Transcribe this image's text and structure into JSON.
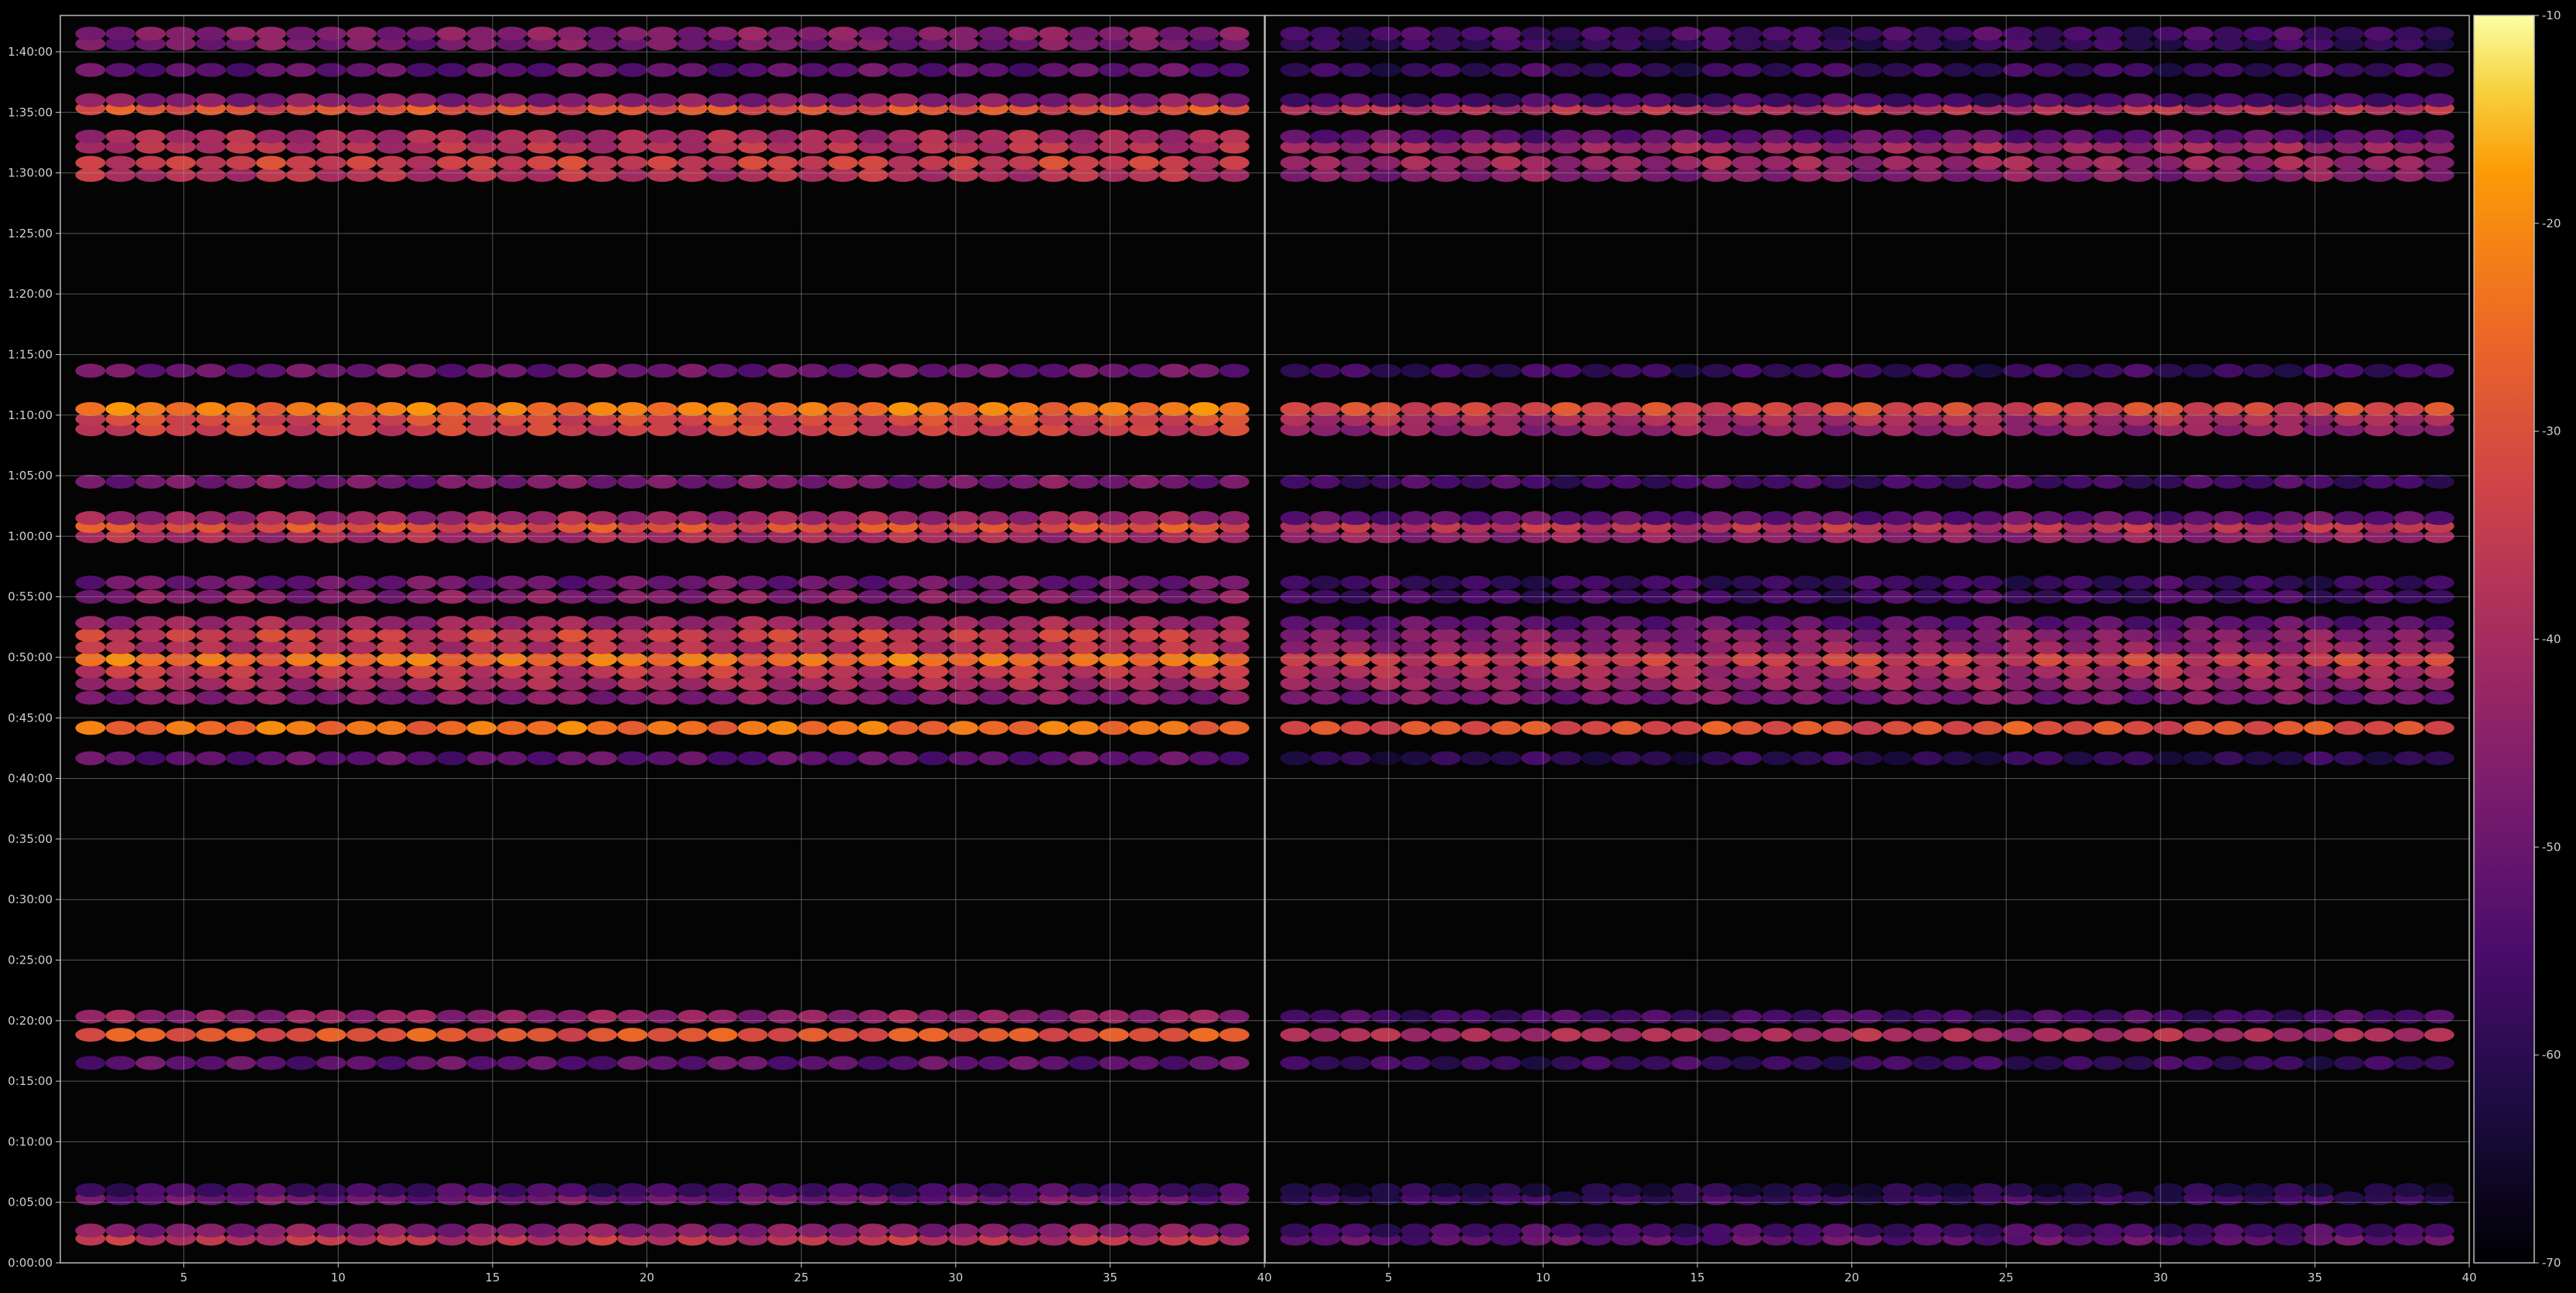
{
  "chart_data": {
    "type": "heatmap",
    "title": "",
    "xlabel": "",
    "ylabel": "",
    "panels": [
      {
        "name": "",
        "xlim": [
          1,
          40
        ],
        "x_ticks": [
          5,
          10,
          15,
          20,
          25,
          30,
          35,
          40
        ]
      },
      {
        "name": "",
        "xlim": [
          1,
          40
        ],
        "x_ticks": [
          5,
          10,
          15,
          20,
          25,
          30,
          35,
          40
        ]
      }
    ],
    "y_range_seconds": [
      0,
      6180
    ],
    "y_ticks": [
      "0:00:00",
      "0:05:00",
      "0:10:00",
      "0:15:00",
      "0:20:00",
      "0:25:00",
      "0:30:00",
      "0:35:00",
      "0:40:00",
      "0:45:00",
      "0:50:00",
      "0:55:00",
      "1:00:00",
      "1:05:00",
      "1:10:00",
      "1:15:00",
      "1:20:00",
      "1:25:00",
      "1:30:00",
      "1:35:00",
      "1:40:00"
    ],
    "grid": true,
    "colormap": "inferno",
    "colorbar": {
      "range": [
        -70,
        -10
      ],
      "ticks": [
        "-10",
        "-20",
        "-30",
        "-40",
        "-50",
        "-60",
        "-70"
      ]
    },
    "bands": [
      {
        "time": "0:02:00",
        "left": -37,
        "right": -52
      },
      {
        "time": "0:02:40",
        "left": -46,
        "right": -56
      },
      {
        "time": "0:05:20",
        "left": -50,
        "right": -58
      },
      {
        "time": "0:06:00",
        "left": -56,
        "right": -62
      },
      {
        "time": "0:16:30",
        "left": -52,
        "right": -58
      },
      {
        "time": "0:18:50",
        "left": -29,
        "right": -40
      },
      {
        "time": "0:20:20",
        "left": -44,
        "right": -56
      },
      {
        "time": "0:41:40",
        "left": -52,
        "right": -60
      },
      {
        "time": "0:44:10",
        "left": -24,
        "right": -30
      },
      {
        "time": "0:46:40",
        "left": -46,
        "right": -48
      },
      {
        "time": "0:47:50",
        "left": -40,
        "right": -43
      },
      {
        "time": "0:48:50",
        "left": -36,
        "right": -40
      },
      {
        "time": "0:49:50",
        "left": -24,
        "right": -34
      },
      {
        "time": "0:50:50",
        "left": -38,
        "right": -44
      },
      {
        "time": "0:51:50",
        "left": -34,
        "right": -46
      },
      {
        "time": "0:52:50",
        "left": -42,
        "right": -52
      },
      {
        "time": "0:55:00",
        "left": -46,
        "right": -56
      },
      {
        "time": "0:56:10",
        "left": -50,
        "right": -58
      },
      {
        "time": "1:00:00",
        "left": -40,
        "right": -44
      },
      {
        "time": "1:00:50",
        "left": -30,
        "right": -37
      },
      {
        "time": "1:01:30",
        "left": -42,
        "right": -52
      },
      {
        "time": "1:04:30",
        "left": -48,
        "right": -56
      },
      {
        "time": "1:08:50",
        "left": -34,
        "right": -44
      },
      {
        "time": "1:09:40",
        "left": -32,
        "right": -40
      },
      {
        "time": "1:10:30",
        "left": -23,
        "right": -32
      },
      {
        "time": "1:13:40",
        "left": -50,
        "right": -58
      },
      {
        "time": "1:29:50",
        "left": -38,
        "right": -46
      },
      {
        "time": "1:30:50",
        "left": -34,
        "right": -42
      },
      {
        "time": "1:32:10",
        "left": -38,
        "right": -42
      },
      {
        "time": "1:33:00",
        "left": -40,
        "right": -52
      },
      {
        "time": "1:35:20",
        "left": -30,
        "right": -38
      },
      {
        "time": "1:36:00",
        "left": -46,
        "right": -56
      },
      {
        "time": "1:38:30",
        "left": -52,
        "right": -58
      },
      {
        "time": "1:40:40",
        "left": -48,
        "right": -58
      },
      {
        "time": "1:41:30",
        "left": -46,
        "right": -56
      }
    ]
  }
}
